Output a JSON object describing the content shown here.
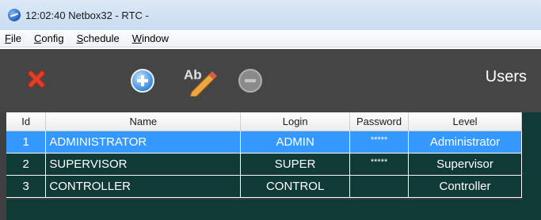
{
  "window": {
    "title": "12:02:40   Netbox32  -  RTC  -"
  },
  "menu": [
    {
      "first": "F",
      "rest": "ile"
    },
    {
      "first": "C",
      "rest": "onfig"
    },
    {
      "first": "S",
      "rest": "chedule"
    },
    {
      "first": "W",
      "rest": "indow"
    }
  ],
  "toolbar": {
    "title": "Users",
    "rename_glyph": "Ab"
  },
  "table": {
    "headers": [
      "Id",
      "Name",
      "Login",
      "Password",
      "Level"
    ],
    "rows": [
      {
        "id": "1",
        "name": "ADMINISTRATOR",
        "login": "ADMIN",
        "password": "*****",
        "level": "Administrator",
        "selected": true
      },
      {
        "id": "2",
        "name": "SUPERVISOR",
        "login": "SUPER",
        "password": "*****",
        "level": "Supervisor",
        "selected": false
      },
      {
        "id": "3",
        "name": "CONTROLLER",
        "login": "CONTROL",
        "password": "",
        "level": "Controller",
        "selected": false
      }
    ]
  },
  "colors": {
    "selected_row": "#3399ff",
    "row_bg": "#0f3a36",
    "toolbar_bg": "#454545"
  },
  "icons": [
    "app-globe-icon",
    "close-x-icon",
    "add-plus-icon",
    "rename-pencil-icon",
    "remove-minus-icon"
  ]
}
